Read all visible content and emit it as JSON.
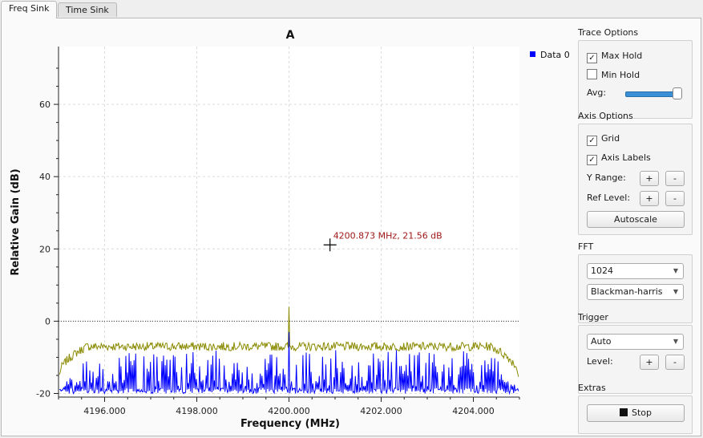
{
  "tabs": [
    {
      "label": "Freq Sink",
      "active": true
    },
    {
      "label": "Time Sink",
      "active": false
    }
  ],
  "plot": {
    "title": "A",
    "marker_text": "4200.873 MHz, 21.56 dB",
    "marker_color": "#a01818"
  },
  "legend": {
    "label": "Data 0",
    "color": "#0000ff"
  },
  "trace_options": {
    "title": "Trace Options",
    "max_hold": {
      "label": "Max Hold",
      "checked": true
    },
    "min_hold": {
      "label": "Min Hold",
      "checked": false
    },
    "avg_label": "Avg:",
    "avg_level": 1.0
  },
  "axis_options": {
    "title": "Axis Options",
    "grid": {
      "label": "Grid",
      "checked": true
    },
    "axis_labels": {
      "label": "Axis Labels",
      "checked": true
    },
    "y_range_label": "Y Range:",
    "ref_level_label": "Ref Level:",
    "plus": "+",
    "minus": "-",
    "autoscale": "Autoscale"
  },
  "fft": {
    "title": "FFT",
    "size": "1024",
    "window": "Blackman-harris"
  },
  "trigger": {
    "title": "Trigger",
    "mode": "Auto",
    "level_label": "Level:"
  },
  "extras": {
    "title": "Extras",
    "stop": "Stop"
  },
  "chart_data": {
    "type": "line",
    "title": "A",
    "xlabel": "Frequency (MHz)",
    "ylabel": "Relative Gain (dB)",
    "xlim": [
      4195.0,
      4205.0
    ],
    "ylim": [
      -21,
      76
    ],
    "x_ticks": [
      4196,
      4198,
      4200,
      4202,
      4204
    ],
    "x_tick_labels": [
      "4196.000",
      "4198.000",
      "4200.000",
      "4202.000",
      "4204.000"
    ],
    "y_ticks": [
      -20,
      0,
      20,
      40,
      60
    ],
    "y_tick_labels": [
      "-20",
      "0",
      "20",
      "40",
      "60"
    ],
    "grid": true,
    "legend_position": "top-right",
    "reference_level": 0,
    "marker": {
      "x": 4200.873,
      "y": 21.56
    },
    "series": [
      {
        "name": "Data 0",
        "color": "#0000ff",
        "noise_floor": -20,
        "typical_peak": -10,
        "peak": {
          "x": 4200.0,
          "y": -3
        }
      },
      {
        "color": "#8a8a00",
        "role": "max hold",
        "edge_level": -15,
        "plateau_level": -7,
        "peak": {
          "x": 4200.0,
          "y": 4
        }
      }
    ]
  }
}
